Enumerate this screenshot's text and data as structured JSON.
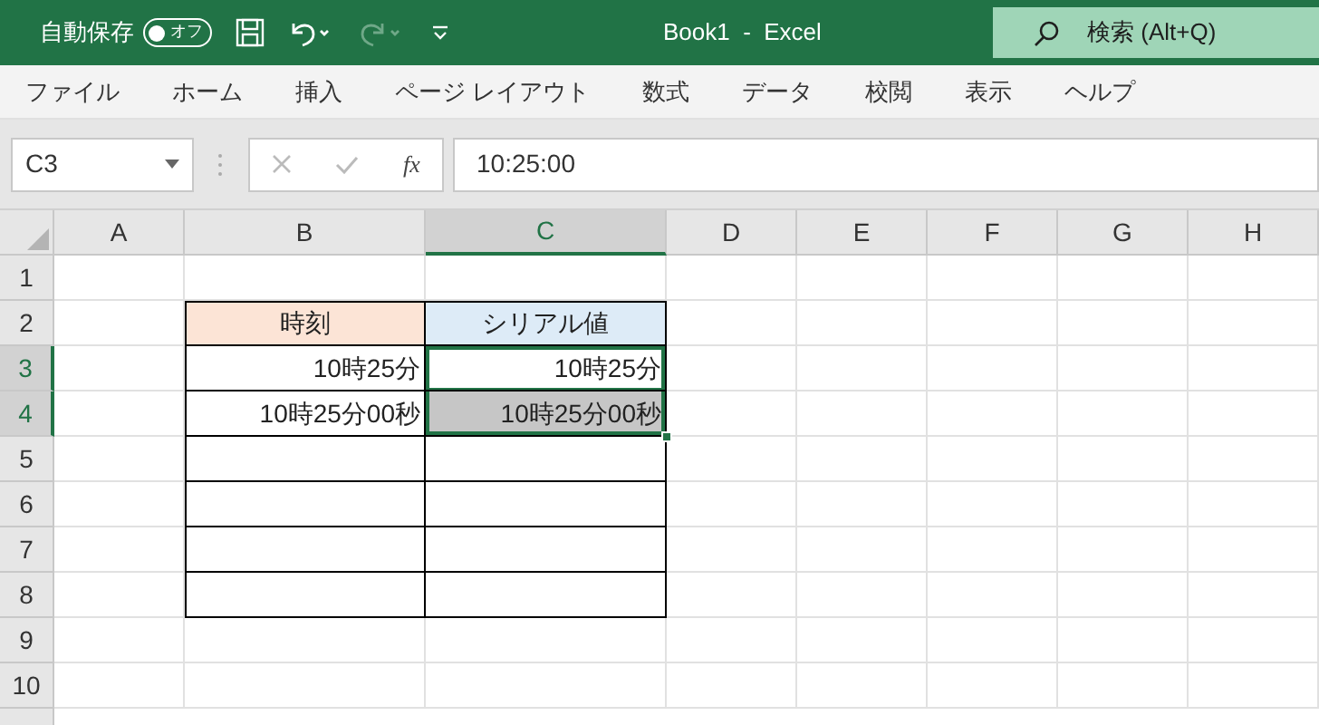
{
  "title_bar": {
    "autosave": {
      "label": "自動保存",
      "on": false,
      "state_text": "オフ"
    },
    "title": "Book1 - Excel",
    "search": {
      "placeholder": "検索 (Alt+Q)"
    }
  },
  "ribbon_tabs": [
    {
      "label": "ファイル"
    },
    {
      "label": "ホーム"
    },
    {
      "label": "挿入"
    },
    {
      "label": "ページ レイアウト"
    },
    {
      "label": "数式"
    },
    {
      "label": "データ"
    },
    {
      "label": "校閲"
    },
    {
      "label": "表示"
    },
    {
      "label": "ヘルプ"
    }
  ],
  "formula_bar": {
    "name_box": "C3",
    "fx": "fx",
    "value": "10:25:00"
  },
  "sheet": {
    "columns": [
      {
        "label": "A",
        "selected": false
      },
      {
        "label": "B",
        "selected": false
      },
      {
        "label": "C",
        "selected": true
      },
      {
        "label": "D",
        "selected": false
      },
      {
        "label": "E",
        "selected": false
      },
      {
        "label": "F",
        "selected": false
      },
      {
        "label": "G",
        "selected": false
      },
      {
        "label": "H",
        "selected": false
      }
    ],
    "rows": [
      {
        "label": "1",
        "selected": false
      },
      {
        "label": "2",
        "selected": false
      },
      {
        "label": "3",
        "selected": true
      },
      {
        "label": "4",
        "selected": true
      },
      {
        "label": "5",
        "selected": false
      },
      {
        "label": "6",
        "selected": false
      },
      {
        "label": "7",
        "selected": false
      },
      {
        "label": "8",
        "selected": false
      },
      {
        "label": "9",
        "selected": false
      },
      {
        "label": "10",
        "selected": false
      }
    ],
    "table": {
      "rows": [
        [
          {
            "text": "時刻",
            "color": "#fce4d6",
            "selected": false,
            "active": false
          },
          {
            "text": "シリアル値",
            "color": "#ddebf7",
            "selected": false,
            "active": false
          }
        ],
        [
          {
            "text": "10時25分",
            "selected": false,
            "active": false
          },
          {
            "text": "10時25分",
            "selected": true,
            "active": true
          }
        ],
        [
          {
            "text": "10時25分00秒",
            "selected": false,
            "active": false
          },
          {
            "text": "10時25分00秒",
            "selected": true,
            "active": false
          }
        ],
        [
          {
            "selected": false,
            "active": false
          },
          {
            "selected": false,
            "active": false
          }
        ],
        [
          {
            "selected": false,
            "active": false
          },
          {
            "selected": false,
            "active": false
          }
        ],
        [
          {
            "selected": false,
            "active": false
          },
          {
            "selected": false,
            "active": false
          }
        ],
        [
          {
            "selected": false,
            "active": false
          },
          {
            "selected": false,
            "active": false
          }
        ]
      ]
    }
  }
}
